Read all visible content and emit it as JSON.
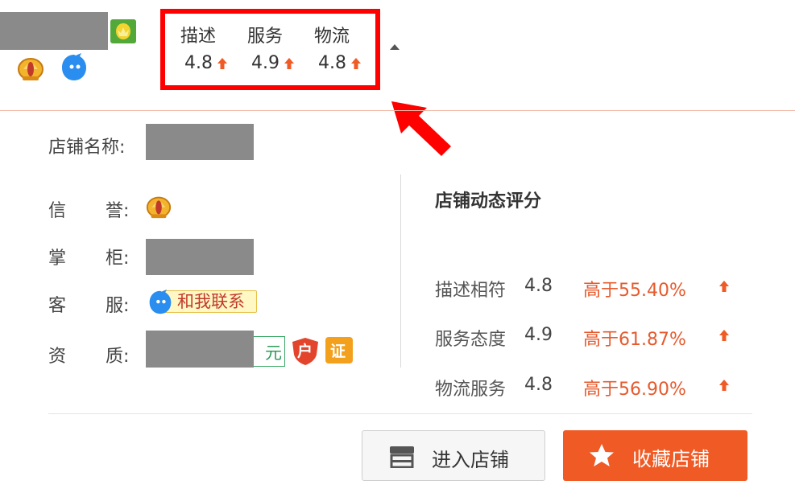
{
  "scores": [
    {
      "label": "描述",
      "value": "4.8"
    },
    {
      "label": "服务",
      "value": "4.9"
    },
    {
      "label": "物流",
      "value": "4.8"
    }
  ],
  "info": {
    "shop_name_label": "店铺名称:",
    "credit_label_1": "信",
    "credit_label_2": "誉:",
    "keeper_label_1": "掌",
    "keeper_label_2": "柜:",
    "service_label_1": "客",
    "service_label_2": "服:",
    "service_contact": "和我联系",
    "cert_label_1": "资",
    "cert_label_2": "质:",
    "cert_tail": "元",
    "cert_badge_1": "户",
    "cert_badge_2": "证"
  },
  "dynamic": {
    "title": "店铺动态评分",
    "rows": [
      {
        "label": "描述相符",
        "value": "4.8",
        "compare": "高于55.40%"
      },
      {
        "label": "服务态度",
        "value": "4.9",
        "compare": "高于61.87%"
      },
      {
        "label": "物流服务",
        "value": "4.8",
        "compare": "高于56.90%"
      }
    ]
  },
  "buttons": {
    "enter_label": "进入店铺",
    "favorite_label": "收藏店铺"
  },
  "colors": {
    "highlight_red": "#ff0000",
    "accent_orange": "#f05a24",
    "compare_text": "#e65a2d"
  },
  "icons": [
    "crown-icon",
    "wangwang-icon",
    "shop-level-icon",
    "up-arrow-icon",
    "dropdown-caret-icon",
    "store-icon",
    "star-icon",
    "callout-arrow-icon"
  ]
}
